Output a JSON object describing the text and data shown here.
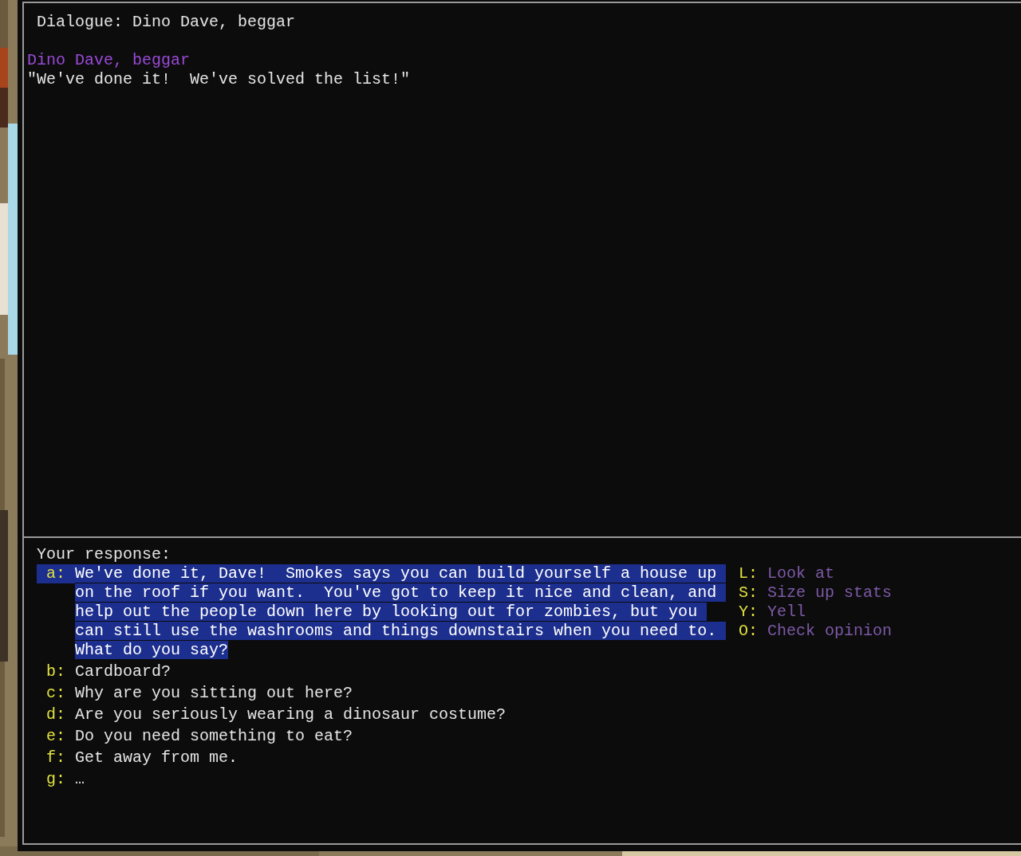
{
  "dialogue_title": "Dialogue: Dino Dave, beggar",
  "speaker": "Dino Dave, beggar",
  "speech": "\"We've done it!  We've solved the list!\"",
  "response_prompt": "Your response:",
  "responses": [
    {
      "key": "a:",
      "text": "We've done it, Dave!  Smokes says you can build yourself a house up on the roof if you want.  You've got to keep it nice and clean, and help out the people down here by looking out for zombies, but you can still use the washrooms and things downstairs when you need to. What do you say?",
      "selected": true
    },
    {
      "key": "b:",
      "text": "Cardboard?",
      "selected": false
    },
    {
      "key": "c:",
      "text": "Why are you sitting out here?",
      "selected": false
    },
    {
      "key": "d:",
      "text": "Are you seriously wearing a dinosaur costume?",
      "selected": false
    },
    {
      "key": "e:",
      "text": "Do you need something to eat?",
      "selected": false
    },
    {
      "key": "f:",
      "text": "Get away from me.",
      "selected": false
    },
    {
      "key": "g:",
      "text": "…",
      "selected": false
    }
  ],
  "actions": [
    {
      "key": "L:",
      "label": "Look at"
    },
    {
      "key": "S:",
      "label": "Size up stats"
    },
    {
      "key": "Y:",
      "label": "Yell"
    },
    {
      "key": "O:",
      "label": "Check opinion"
    }
  ]
}
